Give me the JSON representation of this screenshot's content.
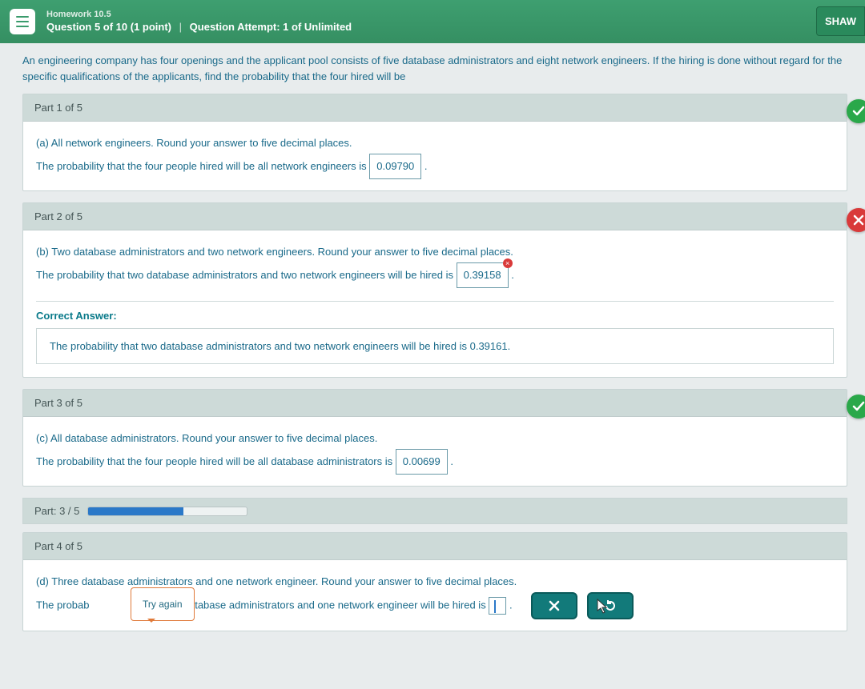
{
  "header": {
    "homework_title": "Homework 10.5",
    "question_line_a": "Question 5 of 10 (1 point)",
    "question_line_b": "Question Attempt: 1 of Unlimited",
    "user_label": "SHAW"
  },
  "intro": "An engineering company has four openings and the applicant pool consists of five database administrators and eight network engineers. If the hiring is done without regard for the specific qualifications of the applicants, find the probability that the four hired will be",
  "parts": {
    "p1": {
      "header": "Part 1 of 5",
      "prompt": "(a) All network engineers. Round your answer to five decimal places.",
      "sentence_pre": "The probability that the four people hired will be all network engineers is ",
      "answer": "0.09790",
      "sentence_post": "."
    },
    "p2": {
      "header": "Part 2 of 5",
      "prompt": "(b) Two database administrators and two network engineers. Round your answer to five decimal places.",
      "sentence_pre": "The probability that two database administrators and two network engineers will be hired is ",
      "answer": "0.39158",
      "sentence_post": ".",
      "correct_label": "Correct Answer:",
      "correct_text": "The probability that two database administrators and two network engineers will be hired is 0.39161."
    },
    "p3": {
      "header": "Part 3 of 5",
      "prompt": "(c) All database administrators. Round your answer to five decimal places.",
      "sentence_pre": "The probability that the four people hired will be all database administrators is ",
      "answer": "0.00699",
      "sentence_post": "."
    },
    "progress": {
      "label": "Part: 3 / 5",
      "percent": 60
    },
    "p4": {
      "header": "Part 4 of 5",
      "prompt": "(d) Three database administrators and one network engineer. Round your answer to five decimal places.",
      "sentence_pre": "The probab",
      "sentence_mid": " database administrators and one network engineer will be hired is ",
      "sentence_post": ".",
      "try_again": "Try again"
    }
  }
}
